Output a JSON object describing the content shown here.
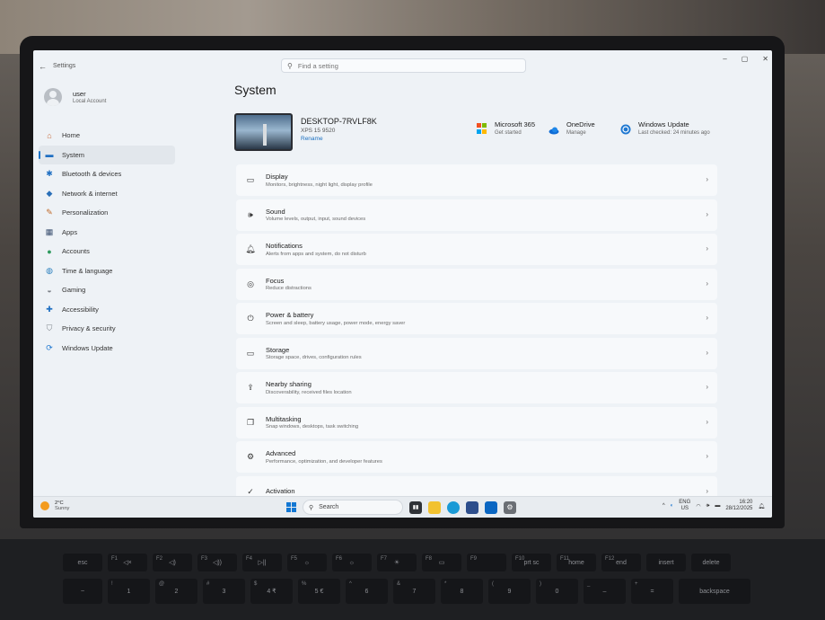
{
  "window": {
    "app_title": "Settings",
    "back_glyph": "←",
    "controls": {
      "minimize": "–",
      "maximize": "▢",
      "close": "✕"
    }
  },
  "search": {
    "placeholder": "Find a setting"
  },
  "user": {
    "name": "user",
    "account_type": "Local Account"
  },
  "sidebar": {
    "items": [
      {
        "label": "Home",
        "icon": "home-icon",
        "glyph": "⌂",
        "color": "#c8693a"
      },
      {
        "label": "System",
        "icon": "system-icon",
        "glyph": "▬",
        "color": "#1f6fc2",
        "active": true
      },
      {
        "label": "Bluetooth & devices",
        "icon": "bluetooth-icon",
        "glyph": "✱",
        "color": "#1f6fc2"
      },
      {
        "label": "Network & internet",
        "icon": "network-icon",
        "glyph": "◆",
        "color": "#2a6fb8"
      },
      {
        "label": "Personalization",
        "icon": "brush-icon",
        "glyph": "✎",
        "color": "#c06a2a"
      },
      {
        "label": "Apps",
        "icon": "apps-icon",
        "glyph": "▦",
        "color": "#3a4f70"
      },
      {
        "label": "Accounts",
        "icon": "accounts-icon",
        "glyph": "●",
        "color": "#2e9a5e"
      },
      {
        "label": "Time & language",
        "icon": "globe-icon",
        "glyph": "◍",
        "color": "#2a7fbe"
      },
      {
        "label": "Gaming",
        "icon": "gamepad-icon",
        "glyph": "◒",
        "color": "#7c8188"
      },
      {
        "label": "Accessibility",
        "icon": "accessibility-icon",
        "glyph": "✚",
        "color": "#1f6fc2"
      },
      {
        "label": "Privacy & security",
        "icon": "shield-icon",
        "glyph": "⛉",
        "color": "#7c8188"
      },
      {
        "label": "Windows Update",
        "icon": "update-icon",
        "glyph": "⟳",
        "color": "#1f78d1"
      }
    ]
  },
  "main": {
    "title": "System",
    "device": {
      "name": "DESKTOP-7RVLF8K",
      "model": "XPS 15 9520",
      "rename_label": "Rename"
    },
    "quick_links": [
      {
        "title": "Microsoft 365",
        "subtitle": "Get started",
        "icon": "microsoft-365-icon"
      },
      {
        "title": "OneDrive",
        "subtitle": "Manage",
        "icon": "onedrive-icon"
      },
      {
        "title": "Windows Update",
        "subtitle": "Last checked: 24 minutes ago",
        "icon": "windows-update-icon"
      }
    ],
    "settings": [
      {
        "title": "Display",
        "subtitle": "Monitors, brightness, night light, display profile",
        "icon": "display-icon",
        "glyph": "▭"
      },
      {
        "title": "Sound",
        "subtitle": "Volume levels, output, input, sound devices",
        "icon": "sound-icon",
        "glyph": "🕪"
      },
      {
        "title": "Notifications",
        "subtitle": "Alerts from apps and system, do not disturb",
        "icon": "bell-icon",
        "glyph": "🔔︎"
      },
      {
        "title": "Focus",
        "subtitle": "Reduce distractions",
        "icon": "focus-icon",
        "glyph": "◎"
      },
      {
        "title": "Power & battery",
        "subtitle": "Screen and sleep, battery usage, power mode, energy saver",
        "icon": "power-icon",
        "glyph": "⏻"
      },
      {
        "title": "Storage",
        "subtitle": "Storage space, drives, configuration rules",
        "icon": "storage-icon",
        "glyph": "▭"
      },
      {
        "title": "Nearby sharing",
        "subtitle": "Discoverability, received files location",
        "icon": "share-icon",
        "glyph": "⇪"
      },
      {
        "title": "Multitasking",
        "subtitle": "Snap windows, desktops, task switching",
        "icon": "multitasking-icon",
        "glyph": "❐"
      },
      {
        "title": "Advanced",
        "subtitle": "Performance, optimization, and developer features",
        "icon": "advanced-icon",
        "glyph": "⚙"
      },
      {
        "title": "Activation",
        "subtitle": "",
        "icon": "activation-icon",
        "glyph": "✓"
      }
    ],
    "chevron": "›"
  },
  "taskbar": {
    "weather": {
      "temp": "2°C",
      "condition": "Sunny"
    },
    "search_label": "Search",
    "lang": "ENG",
    "region": "US",
    "time": "16:20",
    "date": "28/12/2025",
    "tray_chevron": "^"
  },
  "keyboard": {
    "function_row": [
      {
        "label": "esc",
        "sub": ""
      },
      {
        "label": "◁×",
        "sub": "F1"
      },
      {
        "label": "◁)",
        "sub": "F2"
      },
      {
        "label": "◁))",
        "sub": "F3"
      },
      {
        "label": "▷||",
        "sub": "F4"
      },
      {
        "label": "☼",
        "sub": "F5"
      },
      {
        "label": "☼",
        "sub": "F6"
      },
      {
        "label": "☀",
        "sub": "F7"
      },
      {
        "label": "▭",
        "sub": "F8"
      },
      {
        "label": "",
        "sub": "F9"
      },
      {
        "label": "prt sc",
        "sub": "F10"
      },
      {
        "label": "home",
        "sub": "F11"
      },
      {
        "label": "end",
        "sub": "F12"
      },
      {
        "label": "insert",
        "sub": ""
      },
      {
        "label": "delete",
        "sub": ""
      }
    ],
    "number_row": [
      {
        "label": "1",
        "sub": "!"
      },
      {
        "label": "2",
        "sub": "@"
      },
      {
        "label": "3",
        "sub": "#"
      },
      {
        "label": "4 ₹",
        "sub": "$"
      },
      {
        "label": "5 €",
        "sub": "%"
      },
      {
        "label": "6",
        "sub": "^"
      },
      {
        "label": "7",
        "sub": "&"
      },
      {
        "label": "8",
        "sub": "*"
      },
      {
        "label": "9",
        "sub": "("
      },
      {
        "label": "0",
        "sub": ")"
      },
      {
        "label": "–",
        "sub": "_"
      },
      {
        "label": "=",
        "sub": "+"
      },
      {
        "label": "backspace",
        "sub": ""
      }
    ],
    "tilde": {
      "label": "~",
      "sub": ""
    }
  }
}
